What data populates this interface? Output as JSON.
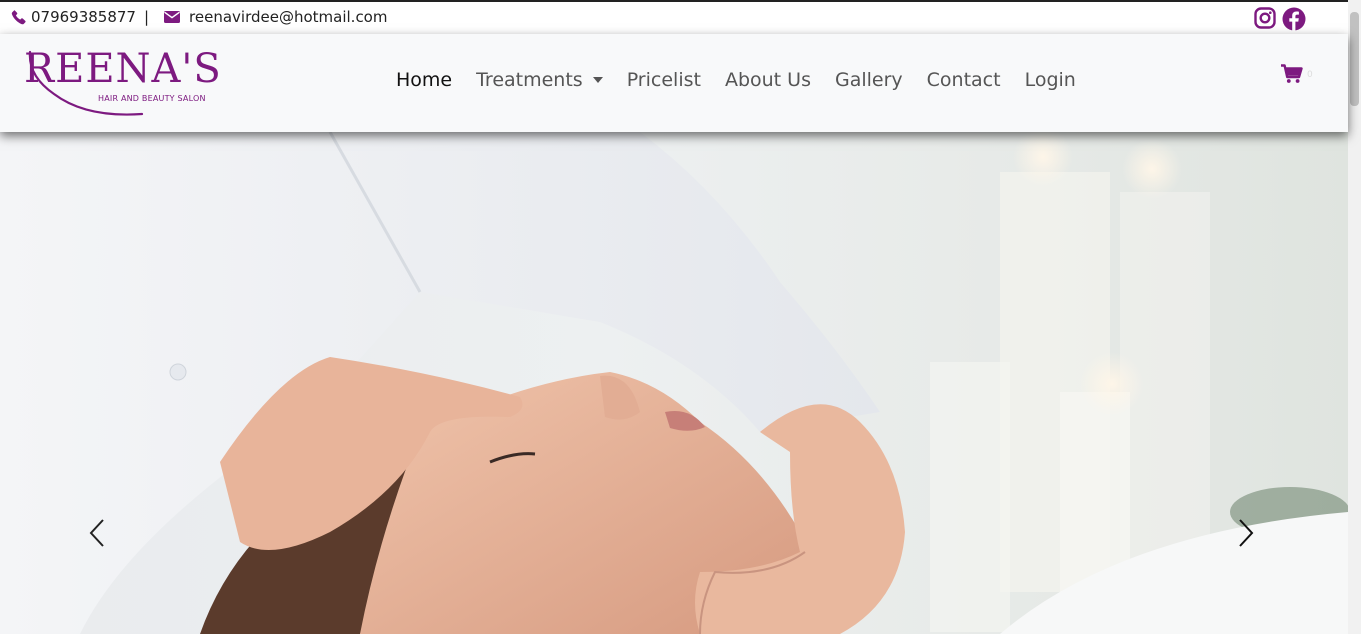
{
  "topbar": {
    "phone": "07969385877",
    "separator": "|",
    "email": "reenavirdee@hotmail.com",
    "social_icons": [
      "instagram-icon",
      "facebook-icon"
    ]
  },
  "logo": {
    "title": "REENA'S",
    "subtitle": "HAIR AND BEAUTY SALON"
  },
  "nav": {
    "items": [
      {
        "label": "Home",
        "active": true
      },
      {
        "label": "Treatments",
        "dropdown": true
      },
      {
        "label": "Pricelist"
      },
      {
        "label": "About Us"
      },
      {
        "label": "Gallery"
      },
      {
        "label": "Contact"
      },
      {
        "label": "Login"
      }
    ]
  },
  "cart": {
    "icon": "cart-icon",
    "count": "0"
  },
  "hero": {
    "prev_icon": "chevron-left-icon",
    "next_icon": "chevron-right-icon"
  },
  "colors": {
    "brand": "#7d1a80",
    "navbar_bg": "#f8f9fa",
    "text": "#212529"
  }
}
